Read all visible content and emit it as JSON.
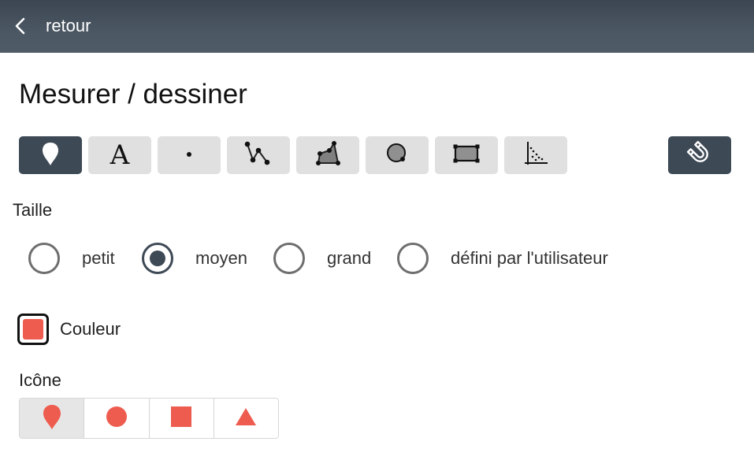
{
  "header": {
    "back_label": "retour",
    "back_icon": "chevron-left-icon"
  },
  "page": {
    "title": "Mesurer / dessiner"
  },
  "toolbar": {
    "tools": [
      {
        "icon": "marker-pin-icon",
        "active": true
      },
      {
        "icon": "text-icon",
        "glyph": "A",
        "active": false
      },
      {
        "icon": "point-icon",
        "active": false
      },
      {
        "icon": "line-icon",
        "active": false
      },
      {
        "icon": "polygon-icon",
        "active": false
      },
      {
        "icon": "circle-icon",
        "active": false
      },
      {
        "icon": "rectangle-icon",
        "active": false
      },
      {
        "icon": "coordinate-axes-icon",
        "active": false
      }
    ],
    "magnet_icon": "magnet-icon"
  },
  "size": {
    "label": "Taille",
    "options": [
      {
        "label": "petit",
        "checked": false
      },
      {
        "label": "moyen",
        "checked": true
      },
      {
        "label": "grand",
        "checked": false
      },
      {
        "label": "défini par l'utilisateur",
        "checked": false
      }
    ]
  },
  "color": {
    "label": "Couleur",
    "value": "#ee5c4f"
  },
  "icon": {
    "label": "Icône",
    "options": [
      {
        "icon": "marker-icon",
        "active": true
      },
      {
        "icon": "circle-icon",
        "active": false
      },
      {
        "icon": "square-icon",
        "active": false
      },
      {
        "icon": "triangle-icon",
        "active": false
      }
    ]
  },
  "colors": {
    "header_bg": "#46525e",
    "active_tool": "#3d4955",
    "inactive_tool": "#e0e0e0",
    "accent_red": "#ee5c4f"
  }
}
